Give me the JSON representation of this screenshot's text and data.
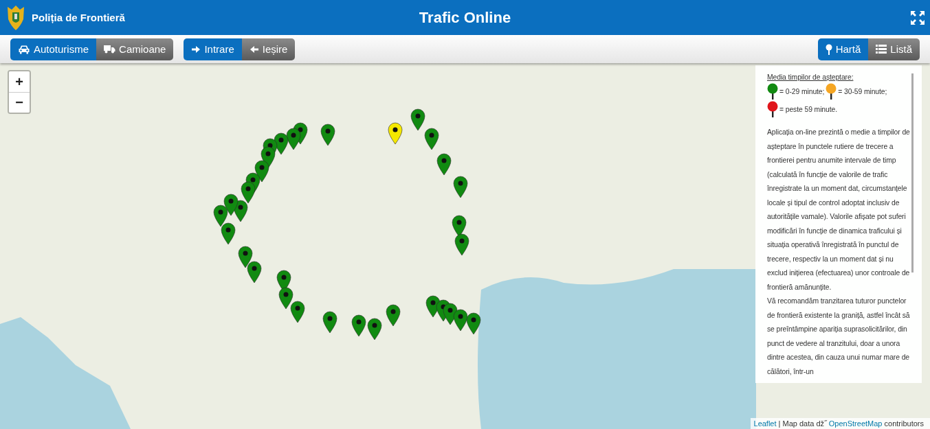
{
  "header": {
    "brand": "Poliția de Frontieră",
    "title": "Trafic Online"
  },
  "toolbar": {
    "vehicle": [
      {
        "label": "Autoturisme",
        "kind": "car",
        "selected": true
      },
      {
        "label": "Camioane",
        "kind": "truck",
        "selected": false
      }
    ],
    "direction": [
      {
        "label": "Intrare",
        "kind": "entry",
        "selected": true
      },
      {
        "label": "Ieșire",
        "kind": "exit",
        "selected": false
      }
    ],
    "view": [
      {
        "label": "Hartă",
        "kind": "map",
        "selected": true
      },
      {
        "label": "Listă",
        "kind": "list",
        "selected": false
      }
    ]
  },
  "map": {
    "zoom": [
      "+",
      "−"
    ],
    "markers": [
      {
        "color": "#118a11"
      },
      {
        "color": "#118a11"
      },
      {
        "color": "#118a11"
      },
      {
        "color": "#118a11"
      },
      {
        "color": "#118a11"
      },
      {
        "color": "#118a11"
      },
      {
        "color": "#118a11"
      },
      {
        "color": "#118a11"
      },
      {
        "color": "#118a11"
      },
      {
        "color": "#118a11"
      },
      {
        "color": "#118a11"
      },
      {
        "color": "#118a11"
      },
      {
        "color": "#118a11"
      },
      {
        "color": "#118a11"
      },
      {
        "color": "#118a11"
      },
      {
        "color": "#118a11"
      },
      {
        "color": "#118a11"
      },
      {
        "color": "#118a11"
      },
      {
        "color": "#118a11"
      },
      {
        "color": "#118a11"
      },
      {
        "color": "#118a11"
      },
      {
        "color": "#118a11"
      },
      {
        "color": "#118a11"
      },
      {
        "color": "#118a11"
      },
      {
        "color": "#118a11"
      },
      {
        "color": "#118a11"
      },
      {
        "color": "#118a11"
      },
      {
        "color": "#118a11"
      },
      {
        "color": "#118a11"
      },
      {
        "color": "#118a11"
      },
      {
        "color": "#118a11"
      },
      {
        "color": "#118a11"
      },
      {
        "color": "#118a11"
      },
      {
        "color": "#f5e800"
      }
    ],
    "legend": {
      "heading": "Media timpilor de așteptare:",
      "items": [
        {
          "color": "#118a11",
          "label": "= 0-29 minute;"
        },
        {
          "color": "#f5a623",
          "label": "= 30-59 minute;"
        },
        {
          "color": "#e0161b",
          "label": "= peste 59 minute."
        }
      ],
      "paragraphs": [
        "Aplicația on-line prezintă o medie a timpilor de așteptare în punctele rutiere de trecere a frontierei pentru anumite intervale de timp (calculată în funcție de valorile de trafic înregistrate la un moment dat, circumstanțele locale și tipul de control adoptat inclusiv de autoritățile vamale). Valorile afișate pot suferi modificări în funcție de dinamica traficului și situația operativă înregistrată în punctul de trecere, respectiv la un moment dat și nu exclud inițierea (efectuarea) unor controale de frontieră amănunțite.",
        "Vă recomandăm tranzitarea tuturor punctelor de frontieră existente la graniță, astfel încât să se preîntâmpine apariția suprasolicitărilor, din punct de vedere al tranzitului, doar a unora dintre acestea, din cauza unui numar mare de călători, într-un"
      ]
    },
    "attribution": {
      "link": "Leaflet",
      "text": "| Map data dž˝",
      "source_link": "OpenStreetMap",
      "suffix": "contributors"
    }
  }
}
